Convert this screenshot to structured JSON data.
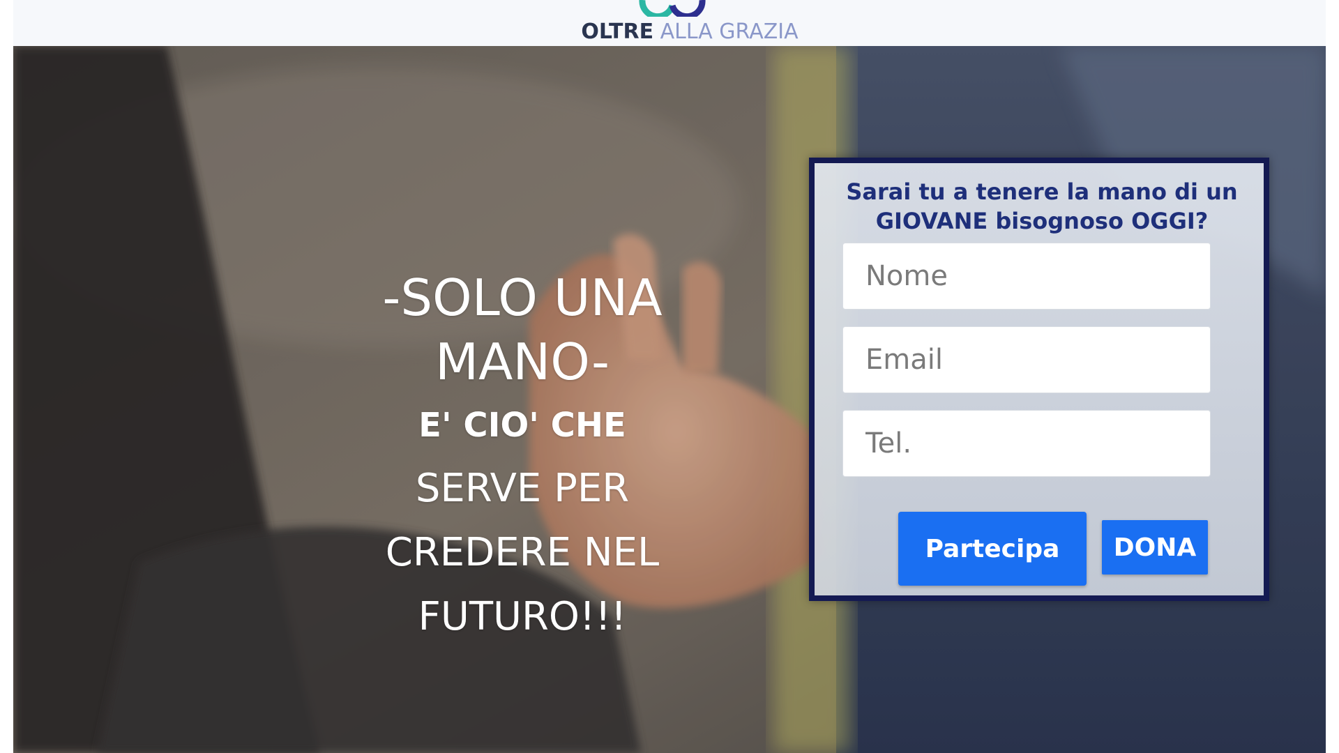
{
  "header": {
    "logo_strong": "OLTRE",
    "logo_light": " ALLA GRAZIA",
    "brand_color": "#2a3550",
    "accent_color": "#8a97c9"
  },
  "hero": {
    "headline_line1": "-SOLO UNA",
    "headline_line2": "MANO-",
    "subline_bold": "E'  CIO' CHE",
    "subline_1": "SERVE PER",
    "subline_2": "CREDERE NEL",
    "subline_3": "FUTURO!!!"
  },
  "form": {
    "title_line1": "Sarai tu a tenere la mano di un",
    "title_line2": "GIOVANE bisognoso OGGI?",
    "name_placeholder": "Nome",
    "email_placeholder": "Email",
    "phone_placeholder": "Tel.",
    "name_value": "",
    "email_value": "",
    "phone_value": "",
    "partecipa_label": "Partecipa",
    "dona_label": "DONA",
    "border_color": "#141a52",
    "button_color": "#1a6ff2"
  }
}
